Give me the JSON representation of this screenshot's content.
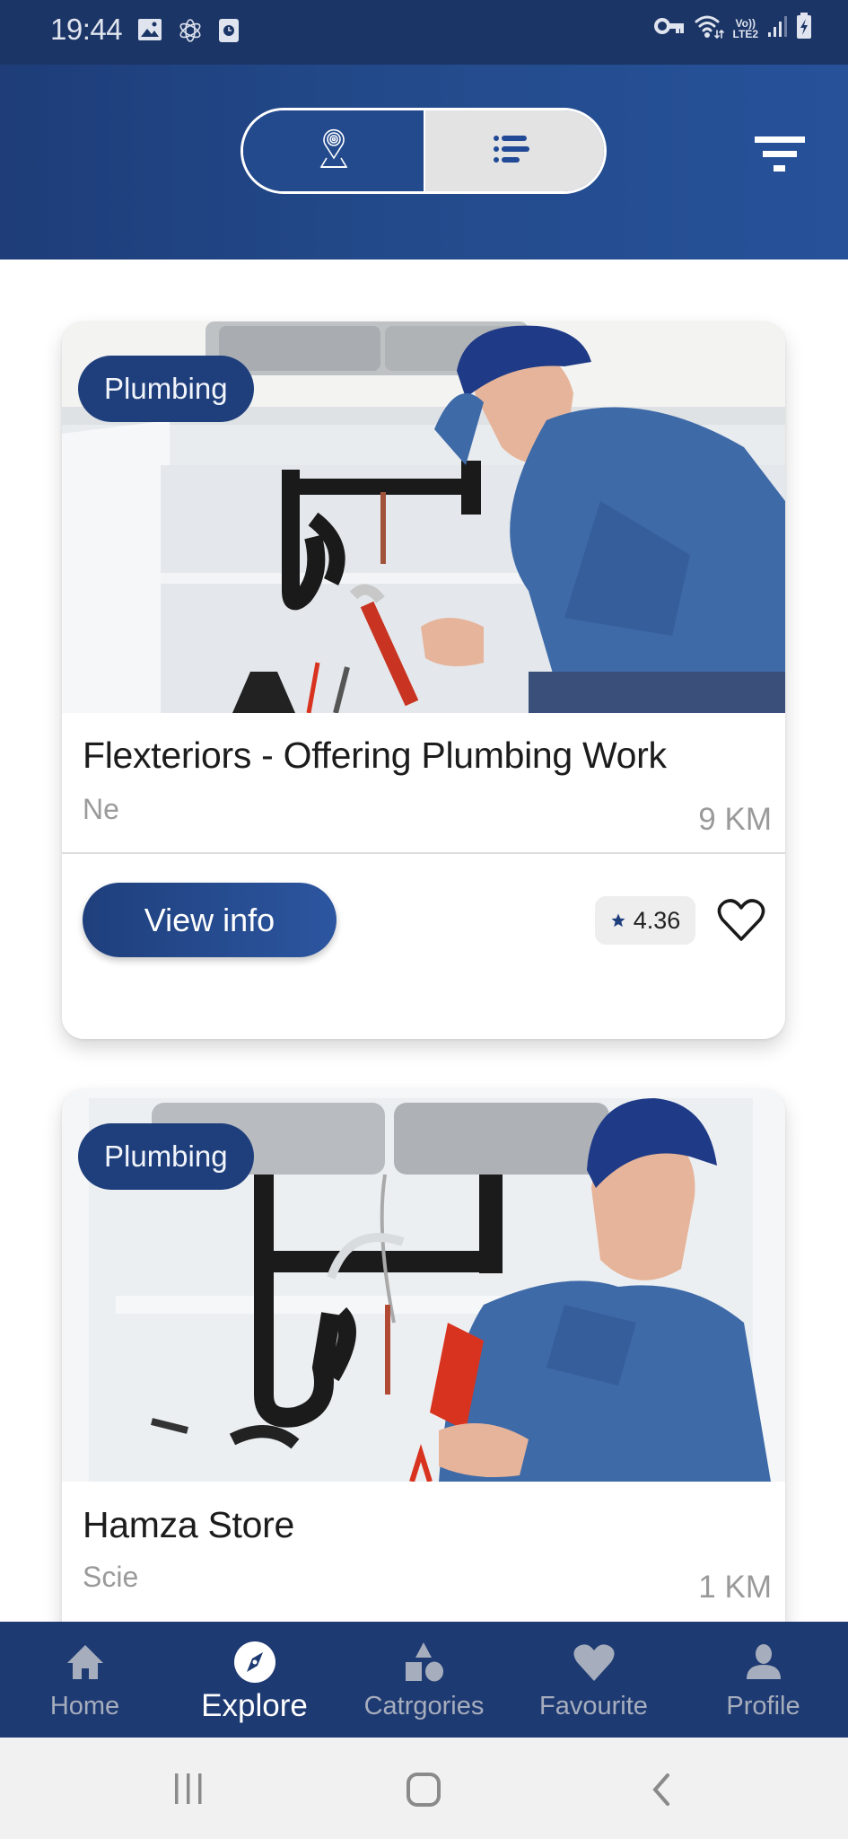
{
  "status_bar": {
    "time": "19:44",
    "left_icons": [
      "gallery-icon",
      "atom-icon",
      "screen-recorder-icon"
    ],
    "right_icons": [
      "vpn-key-icon",
      "wifi-icon",
      "lte-icon",
      "signal-icon",
      "battery-charging-icon"
    ],
    "lte_line1": "Vo))",
    "lte_line2": "LTE2"
  },
  "header": {
    "view_toggle": {
      "options": [
        {
          "name": "map-view",
          "icon": "map-pin-icon",
          "selected": false
        },
        {
          "name": "list-view",
          "icon": "list-icon",
          "selected": true
        }
      ]
    },
    "filter_icon": "filter-icon"
  },
  "colors": {
    "brand": "#1f3f7c",
    "header_start": "#1e3d79",
    "header_end": "#27529a",
    "nav_background": "#1e3a72",
    "nav_inactive": "#a6adbd",
    "muted_text": "#9a9a9a"
  },
  "listings": [
    {
      "category": "Plumbing",
      "title": "Flexteriors - Offering Plumbing Work",
      "subtitle": "Ne",
      "distance": "9 KM",
      "button_label": "View info",
      "rating": "4.36",
      "favourite": false
    },
    {
      "category": "Plumbing",
      "title": "Hamza Store",
      "subtitle": "Scie",
      "distance": "1 KM"
    }
  ],
  "bottom_nav": {
    "items": [
      {
        "label": "Home",
        "icon": "home-icon",
        "active": false
      },
      {
        "label": "Explore",
        "icon": "compass-icon",
        "active": true
      },
      {
        "label": "Catrgories",
        "icon": "categories-shapes-icon",
        "active": false
      },
      {
        "label": "Favourite",
        "icon": "heart-icon",
        "active": false
      },
      {
        "label": "Profile",
        "icon": "person-icon",
        "active": false
      }
    ]
  },
  "system_nav": {
    "buttons": [
      "recent-apps",
      "home",
      "back"
    ]
  }
}
